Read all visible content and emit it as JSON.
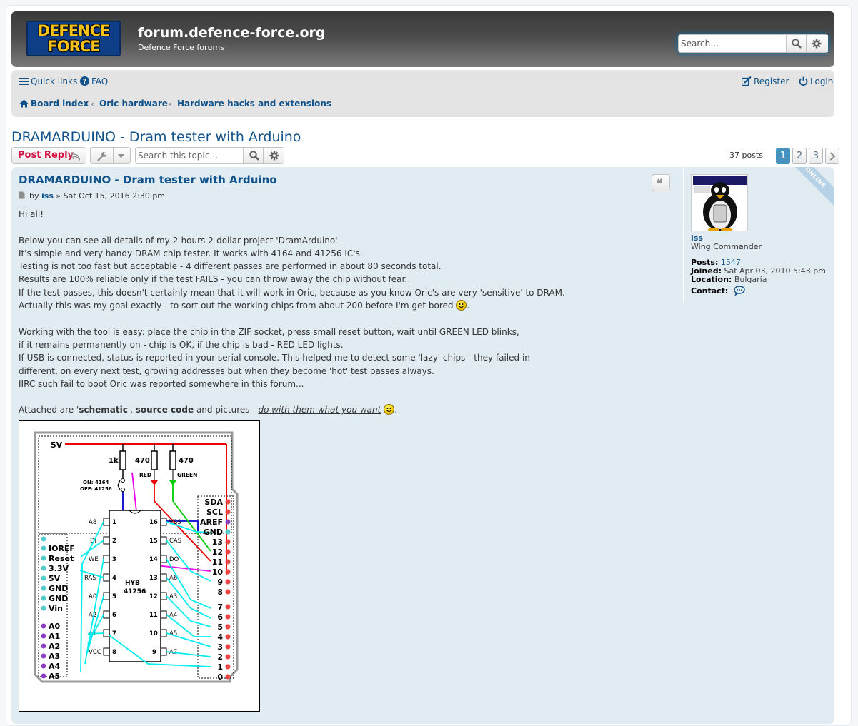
{
  "header": {
    "logo_line1": "DEFENCE",
    "logo_line2": "FORCE",
    "site_title": "forum.defence-force.org",
    "site_description": "Defence Force forums",
    "search_placeholder": "Search…"
  },
  "nav": {
    "quick_links": "Quick links",
    "faq": "FAQ",
    "register": "Register",
    "login": "Login",
    "breadcrumbs": [
      "Board index",
      "Oric hardware",
      "Hardware hacks and extensions"
    ]
  },
  "topic": {
    "title": "DRAMARDUINO - Dram tester with Arduino",
    "post_reply": "Post Reply",
    "search_placeholder": "Search this topic…",
    "post_count": "37 posts",
    "pages": [
      "1",
      "2",
      "3"
    ],
    "current_page": "1"
  },
  "post": {
    "title": "DRAMARDUINO - Dram tester with Arduino",
    "by": "by",
    "author": "iss",
    "date": "» Sat Oct 15, 2016 2:30 pm",
    "lines": [
      "Hi all!",
      "",
      "Below you can see all details of my 2-hours 2-dollar project 'DramArduino'.",
      "It's simple and very handy DRAM chip tester. It works with 4164 and 41256 IC's.",
      "Testing is not too fast but acceptable - 4 different passes are performed in about 80 seconds total.",
      "Results are 100% reliable only if the test FAILS - you can throw away the chip without fear.",
      "If the test passes, this doesn't certainly mean that it will work in Oric, because as you know Oric's are very 'sensitive' to DRAM.",
      "Actually this was my goal exactly - to sort out the working chips from about 200 before I'm get bored",
      "",
      "Working with the tool is easy: place the chip in the ZIF socket, press small reset button, wait until GREEN LED blinks,",
      "if it remains permanently on - chip is OK, if the chip is bad - RED LED lights.",
      "If USB is connected, status is reported in your serial console. This helped me to detect some 'lazy' chips - they failed in",
      "different, on every next test, growing addresses but when they become 'hot' test passes always.",
      "IIRC such fail to boot Oric was reported somewhere in this forum..."
    ],
    "attached_prefix": "Attached are '",
    "attached_schematic": "schematic",
    "attached_mid1": "', ",
    "attached_source": "source code",
    "attached_mid2": " and pictures - ",
    "attached_link": "do with them what you want",
    "attached_end": "."
  },
  "schematic": {
    "v5": "5V",
    "r1": "1k",
    "r2": "470",
    "r3": "470",
    "red": "RED",
    "green": "GREEN",
    "switch1": "ON: 4164",
    "switch2": "OFF: 41256",
    "chip1": "HYB",
    "chip2": "41256",
    "left_pins": [
      "A8",
      "DI",
      "WE",
      "RAS",
      "A0",
      "A2",
      "A1",
      "VCC"
    ],
    "left_nums": [
      "1",
      "2",
      "3",
      "4",
      "5",
      "6",
      "7",
      "8"
    ],
    "right_nums": [
      "16",
      "15",
      "14",
      "13",
      "12",
      "11",
      "10",
      "9"
    ],
    "right_pins": [
      "VSS",
      "CAS",
      "DO",
      "A6",
      "A3",
      "A4",
      "A5",
      "A7"
    ],
    "header_left": [
      "IOREF",
      "Reset",
      "3.3V",
      "5V",
      "GND",
      "GND",
      "Vin"
    ],
    "header_analog": [
      "A0",
      "A1",
      "A2",
      "A3",
      "A4",
      "A5"
    ],
    "header_right_top": [
      "SDA",
      "SCL",
      "AREF",
      "GND",
      "13",
      "12",
      "11",
      "10",
      "9",
      "8"
    ],
    "header_right_bottom": [
      "7",
      "6",
      "5",
      "4",
      "3",
      "2",
      "1",
      "0"
    ]
  },
  "profile": {
    "online": "ONLINE",
    "username": "iss",
    "rank": "Wing Commander",
    "posts_label": "Posts:",
    "posts_value": "1547",
    "joined_label": "Joined:",
    "joined_value": "Sat Apr 03, 2010 5:43 pm",
    "location_label": "Location:",
    "location_value": "Bulgaria",
    "contact_label": "Contact:"
  },
  "colors": {
    "link": "#105289",
    "post_bg": "#e1ebf2",
    "reply_red": "#d31141",
    "active_page": "#4692bf"
  }
}
